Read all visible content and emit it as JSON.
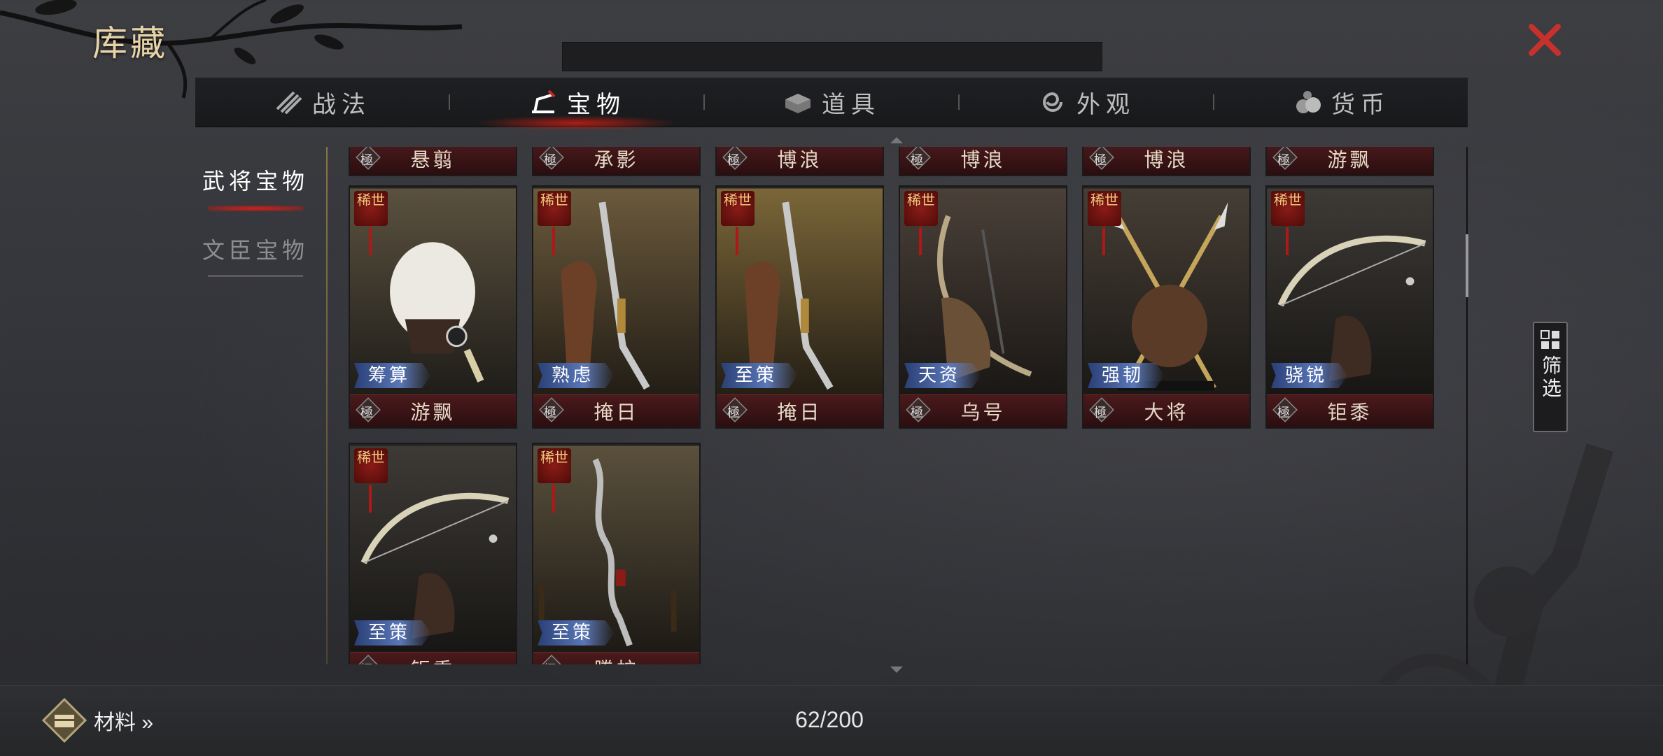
{
  "header": {
    "title": "库藏"
  },
  "tabs": [
    {
      "label": "战法",
      "icon": "scroll-bundle-icon",
      "active": false
    },
    {
      "label": "宝物",
      "icon": "treasure-stand-icon",
      "active": true
    },
    {
      "label": "道具",
      "icon": "item-box-icon",
      "active": false
    },
    {
      "label": "外观",
      "icon": "swirl-icon",
      "active": false
    },
    {
      "label": "货币",
      "icon": "coin-bag-icon",
      "active": false
    }
  ],
  "sidebar": [
    {
      "label": "武将宝物",
      "active": true
    },
    {
      "label": "文臣宝物",
      "active": false
    }
  ],
  "grid": {
    "grade_label": "極",
    "rare_label": "稀世",
    "top_row": [
      "悬翦",
      "承影",
      "博浪",
      "博浪",
      "博浪",
      "游飘"
    ],
    "row2": [
      {
        "skill": "筹算",
        "name": "游飘",
        "art": "feather-fan"
      },
      {
        "skill": "熟虑",
        "name": "掩日",
        "art": "blade"
      },
      {
        "skill": "至策",
        "name": "掩日",
        "art": "blade"
      },
      {
        "skill": "天资",
        "name": "乌号",
        "art": "bow-stand"
      },
      {
        "skill": "强韧",
        "name": "大将",
        "art": "spears"
      },
      {
        "skill": "骁锐",
        "name": "钜黍",
        "art": "bow"
      }
    ],
    "row3": [
      {
        "skill": "至策",
        "name": "钜黍",
        "art": "bow"
      },
      {
        "skill": "至策",
        "name": "騰蛇",
        "art": "wavy-blade"
      }
    ]
  },
  "filter": {
    "label": "筛选"
  },
  "footer": {
    "materials_label": "材料 »",
    "count": "62/200"
  },
  "colors": {
    "accent_red": "#c62a20",
    "gold_title": "#e7d3a7",
    "skill_tag_blue": "#4a66a8",
    "name_bar": "#3b1416"
  }
}
